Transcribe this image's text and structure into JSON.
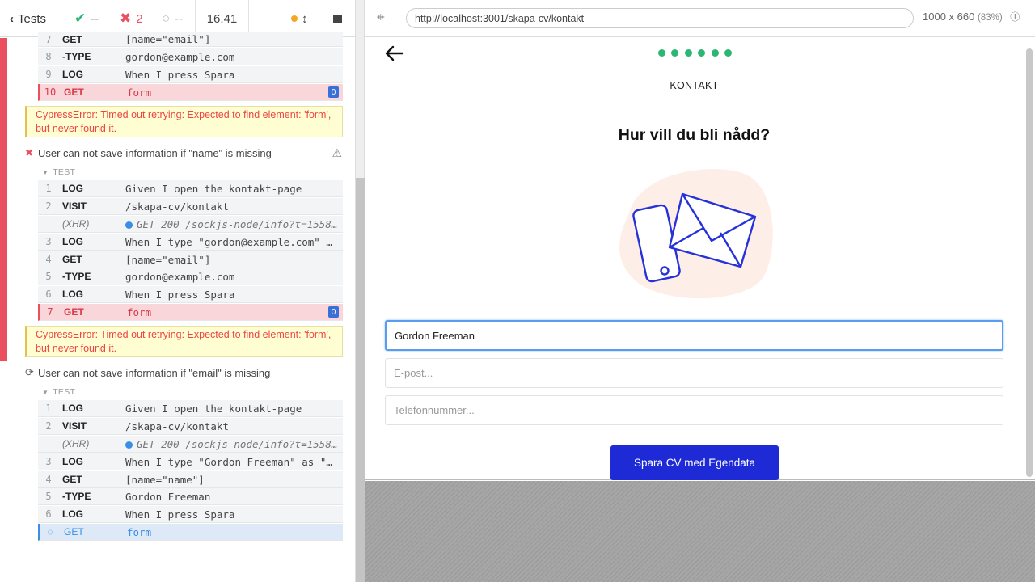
{
  "header": {
    "back_label": "Tests",
    "passed": "--",
    "failed": "2",
    "pending": "--",
    "duration": "16.41"
  },
  "commands_top": [
    {
      "num": "7",
      "name": "GET",
      "msg": "[name=\"email\"]"
    },
    {
      "num": "8",
      "name": "-TYPE",
      "msg": "gordon@example.com"
    },
    {
      "num": "9",
      "name": "LOG",
      "msg": "When I press Spara"
    },
    {
      "num": "10",
      "name": "GET",
      "msg": "form",
      "badge": "0"
    }
  ],
  "error1": "CypressError: Timed out retrying: Expected to find element: 'form', but never found it.",
  "test2": {
    "title": "User can not save information if \"name\" is missing",
    "label": "TEST",
    "commands": [
      {
        "num": "1",
        "name": "LOG",
        "msg": "Given I open the kontakt-page"
      },
      {
        "num": "2",
        "name": "VISIT",
        "msg": "/skapa-cv/kontakt"
      },
      {
        "num": "",
        "name": "(XHR)",
        "msg": "GET 200 /sockjs-node/info?t=15584…"
      },
      {
        "num": "3",
        "name": "LOG",
        "msg": "When I type \"gordon@example.com\" as…"
      },
      {
        "num": "4",
        "name": "GET",
        "msg": "[name=\"email\"]"
      },
      {
        "num": "5",
        "name": "-TYPE",
        "msg": "gordon@example.com"
      },
      {
        "num": "6",
        "name": "LOG",
        "msg": "When I press Spara"
      },
      {
        "num": "7",
        "name": "GET",
        "msg": "form",
        "badge": "0"
      }
    ]
  },
  "error2": "CypressError: Timed out retrying: Expected to find element: 'form', but never found it.",
  "test3": {
    "title": "User can not save information if \"email\" is missing",
    "label": "TEST",
    "commands": [
      {
        "num": "1",
        "name": "LOG",
        "msg": "Given I open the kontakt-page"
      },
      {
        "num": "2",
        "name": "VISIT",
        "msg": "/skapa-cv/kontakt"
      },
      {
        "num": "",
        "name": "(XHR)",
        "msg": "GET 200 /sockjs-node/info?t=15584…"
      },
      {
        "num": "3",
        "name": "LOG",
        "msg": "When I type \"Gordon Freeman\" as \"na…"
      },
      {
        "num": "4",
        "name": "GET",
        "msg": "[name=\"name\"]"
      },
      {
        "num": "5",
        "name": "-TYPE",
        "msg": "Gordon Freeman"
      },
      {
        "num": "6",
        "name": "LOG",
        "msg": "When I press Spara"
      },
      {
        "num": "",
        "name": "GET",
        "msg": "form"
      }
    ]
  },
  "aut": {
    "url": "http://localhost:3001/skapa-cv/kontakt",
    "viewport": "1000 x 660",
    "zoom": "(83%)",
    "page_label": "KONTAKT",
    "heading": "Hur vill du bli nådd?",
    "name_value": "Gordon Freeman",
    "email_placeholder": "E-post...",
    "phone_placeholder": "Telefonnummer...",
    "submit_label": "Spara CV med Egendata",
    "progress_steps": 6,
    "accent_color": "#2bb673",
    "button_color": "#1e2ad6"
  }
}
